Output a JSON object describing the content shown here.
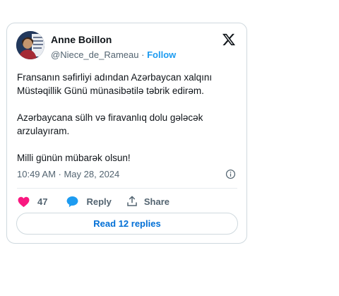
{
  "author": {
    "name": "Anne Boillon",
    "handle": "@Niece_de_Rameau",
    "separator": "·",
    "follow_label": "Follow"
  },
  "tweet": {
    "paragraph_1": "Fransanın səfirliyi adından Azərbaycan xalqını Müstəqillik Günü münasibətilə təbrik edirəm.",
    "paragraph_2": "Azərbaycana sülh və firavanlıq dolu gələcək arzulayıram.",
    "paragraph_3": "Milli günün mübarək olsun!",
    "timestamp": "10:49 AM · May 28, 2024"
  },
  "actions": {
    "like_count": "47",
    "reply_label": "Reply",
    "share_label": "Share"
  },
  "read_replies_label": "Read 12 replies",
  "colors": {
    "like": "#f91880",
    "reply": "#1d9bf0",
    "link": "#1d9bf0",
    "button_text": "#006fd6",
    "border": "#cfd9de",
    "secondary_text": "#536471"
  },
  "icons": {
    "platform": "x-logo-icon",
    "info": "info-icon",
    "like": "heart-icon",
    "reply": "speech-bubble-icon",
    "share": "share-upload-icon"
  }
}
